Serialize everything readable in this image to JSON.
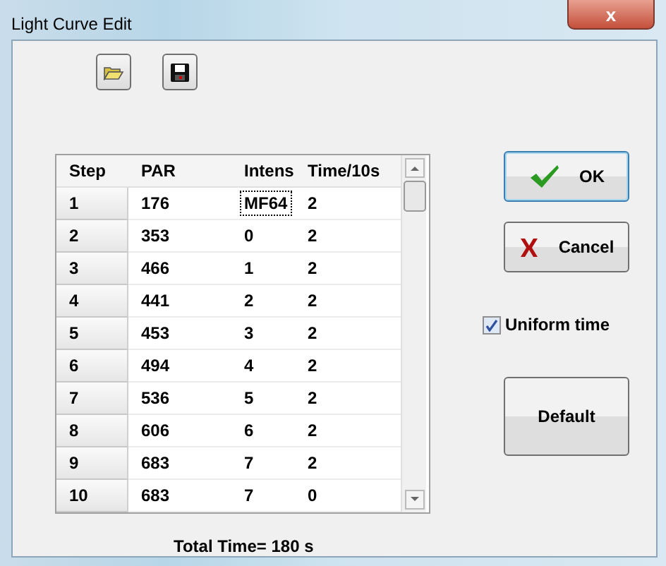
{
  "window": {
    "title": "Light Curve Edit",
    "close_label": "x"
  },
  "toolbar": [
    {
      "kind": "open"
    },
    {
      "kind": "save"
    }
  ],
  "table": {
    "columns": [
      "Step",
      "PAR",
      "Intens",
      "Time/10s"
    ],
    "rows": [
      {
        "step": "1",
        "par": "176",
        "intens": "MF64",
        "time": "2",
        "focused": true
      },
      {
        "step": "2",
        "par": "353",
        "intens": "0",
        "time": "2",
        "focused": false
      },
      {
        "step": "3",
        "par": "466",
        "intens": "1",
        "time": "2",
        "focused": false
      },
      {
        "step": "4",
        "par": "441",
        "intens": "2",
        "time": "2",
        "focused": false
      },
      {
        "step": "5",
        "par": "453",
        "intens": "3",
        "time": "2",
        "focused": false
      },
      {
        "step": "6",
        "par": "494",
        "intens": "4",
        "time": "2",
        "focused": false
      },
      {
        "step": "7",
        "par": "536",
        "intens": "5",
        "time": "2",
        "focused": false
      },
      {
        "step": "8",
        "par": "606",
        "intens": "6",
        "time": "2",
        "focused": false
      },
      {
        "step": "9",
        "par": "683",
        "intens": "7",
        "time": "2",
        "focused": false
      },
      {
        "step": "10",
        "par": "683",
        "intens": "7",
        "time": "0",
        "focused": false
      }
    ]
  },
  "total": "Total Time= 180 s",
  "buttons": [
    {
      "kind": "ok",
      "label": "OK",
      "default": true
    },
    {
      "kind": "cancel",
      "label": "Cancel",
      "default": false
    }
  ],
  "uniform_time": {
    "label": "Uniform time",
    "checked": true
  },
  "default_button": {
    "label": "Default"
  }
}
